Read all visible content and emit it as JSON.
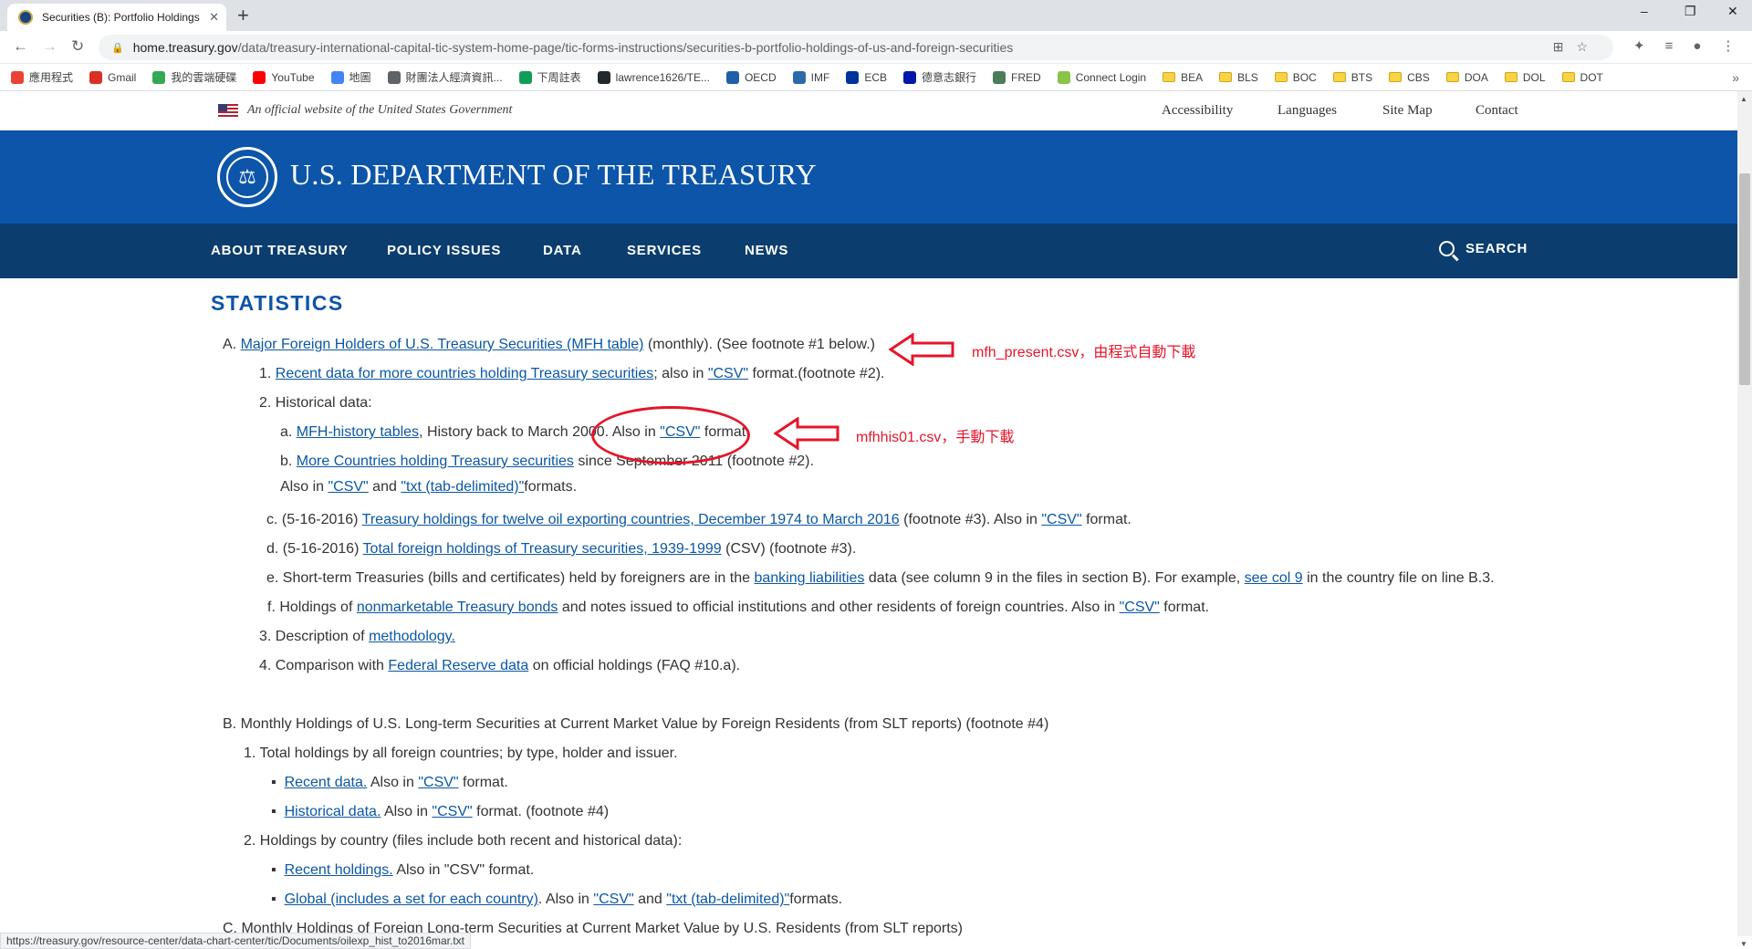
{
  "browser": {
    "tab_title": "Securities (B): Portfolio Holdings",
    "tab_close": "✕",
    "new_tab": "+",
    "url_host": "home.treasury.gov",
    "url_path": "/data/treasury-international-capital-tic-system-home-page/tic-forms-instructions/securities-b-portfolio-holdings-of-us-and-foreign-securities",
    "window_controls": [
      "–",
      "❐",
      "✕"
    ],
    "bookmarks": [
      {
        "label": "應用程式",
        "color": "#ea4335"
      },
      {
        "label": "Gmail",
        "color": "#d93025"
      },
      {
        "label": "我的雲端硬碟",
        "color": "#34a853"
      },
      {
        "label": "YouTube",
        "color": "#ff0000"
      },
      {
        "label": "地圖",
        "color": "#4285f4"
      },
      {
        "label": "財團法人經濟資訊...",
        "color": "#5f6368"
      },
      {
        "label": "下周註表",
        "color": "#0f9d58"
      },
      {
        "label": "lawrence1626/TE...",
        "color": "#24292e"
      },
      {
        "label": "OECD",
        "color": "#1f5fa8"
      },
      {
        "label": "IMF",
        "color": "#2a6aa8"
      },
      {
        "label": "ECB",
        "color": "#003299"
      },
      {
        "label": "德意志銀行",
        "color": "#0018a8"
      },
      {
        "label": "FRED",
        "color": "#4a7c59"
      },
      {
        "label": "Connect Login",
        "color": "#8bc34a"
      },
      {
        "label": "BEA",
        "folder": true
      },
      {
        "label": "BLS",
        "folder": true
      },
      {
        "label": "BOC",
        "folder": true
      },
      {
        "label": "BTS",
        "folder": true
      },
      {
        "label": "CBS",
        "folder": true
      },
      {
        "label": "DOA",
        "folder": true
      },
      {
        "label": "DOL",
        "folder": true
      },
      {
        "label": "DOT",
        "folder": true
      }
    ],
    "bookmarks_more": "»",
    "status_url": "https://treasury.gov/resource-center/data-chart-center/tic/Documents/oilexp_hist_to2016mar.txt"
  },
  "banner": {
    "official": "An official website of the United States Government",
    "links": [
      "Accessibility",
      "Languages",
      "Site Map",
      "Contact"
    ]
  },
  "header": {
    "dept_name": "U.S. DEPARTMENT OF THE TREASURY"
  },
  "nav": {
    "items": [
      "ABOUT TREASURY",
      "POLICY ISSUES",
      "DATA",
      "SERVICES",
      "NEWS"
    ],
    "search": "SEARCH"
  },
  "content": {
    "heading": "STATISTICS",
    "a": {
      "prefix": "A.",
      "link": "Major Foreign Holders of U.S. Treasury Securities (MFH table)",
      "suffix": " (monthly). (See footnote #1 below.)"
    },
    "a1": {
      "prefix": "1.",
      "link": "Recent data for more countries holding Treasury securities",
      "mid": "; also in ",
      "csv": "\"CSV\"",
      "suffix": " format.(footnote #2)."
    },
    "a2": "2. Historical data:",
    "a2a": {
      "prefix": "a.",
      "link": "MFH-history tables",
      "mid": ", History back to March 2000. Also in ",
      "csv": "\"CSV\"",
      "suffix": " format."
    },
    "a2b": {
      "prefix": "b.",
      "link": "More Countries holding Treasury securities",
      "suffix": " since September 2011 (footnote #2)."
    },
    "a2b2": {
      "prefix": "Also in ",
      "csv": "\"CSV\"",
      "mid": " and ",
      "txt": "\"txt (tab-delimited)\"",
      "suffix": "formats."
    },
    "a2c": {
      "prefix": "c. (5-16-2016) ",
      "link": "Treasury holdings for twelve oil exporting countries, December 1974 to March 2016",
      "mid": " (footnote #3). Also in ",
      "csv": "\"CSV\"",
      "suffix": " format."
    },
    "a2d": {
      "prefix": "d. (5-16-2016) ",
      "link": "Total foreign holdings of Treasury securities, 1939-1999",
      "suffix": " (CSV) (footnote #3)."
    },
    "a2e": {
      "prefix": "e. Short-term Treasuries (bills and certificates) held by foreigners are in the ",
      "link": "banking liabilities",
      "mid": " data (see column 9 in the files in section B). For example, ",
      "link2": "see col 9",
      "suffix": " in the country file on line B.3."
    },
    "a2f": {
      "prefix": "f. Holdings of ",
      "link": "nonmarketable Treasury bonds",
      "mid": " and notes issued to official institutions and other residents of foreign countries. Also in ",
      "csv": "\"CSV\"",
      "suffix": " format."
    },
    "a3": {
      "prefix": "3. Description of ",
      "link": "methodology."
    },
    "a4": {
      "prefix": "4. Comparison with ",
      "link": "Federal Reserve data",
      "suffix": " on official holdings (FAQ #10.a)."
    },
    "b": "B. Monthly Holdings of U.S. Long-term Securities at Current Market Value by Foreign Residents (from SLT reports) (footnote #4)",
    "b1": "1. Total holdings by all foreign countries; by type, holder and issuer.",
    "b1a": {
      "link": "Recent data.",
      "mid": " Also in ",
      "csv": "\"CSV\"",
      "suffix": " format."
    },
    "b1b": {
      "link": "Historical data.",
      "mid": " Also in ",
      "csv": "\"CSV\"",
      "suffix": " format. (footnote #4)"
    },
    "b2": "2. Holdings by country (files include both recent and historical data):",
    "b2a": {
      "link": "Recent holdings.",
      "suffix": " Also in \"CSV\" format."
    },
    "b2b": {
      "link": "Global (includes a set for each country)",
      "mid": ". Also in ",
      "csv": "\"CSV\"",
      "mid2": " and ",
      "txt": "\"txt (tab-delimited)\"",
      "suffix": "formats."
    },
    "c": "C. Monthly Holdings of Foreign Long-term Securities at Current Market Value by U.S. Residents (from SLT reports)"
  },
  "annotations": {
    "note1": "mfh_present.csv，由程式自動下載",
    "note2": "mfhhis01.csv，手動下載",
    "color": "#e4162b"
  }
}
